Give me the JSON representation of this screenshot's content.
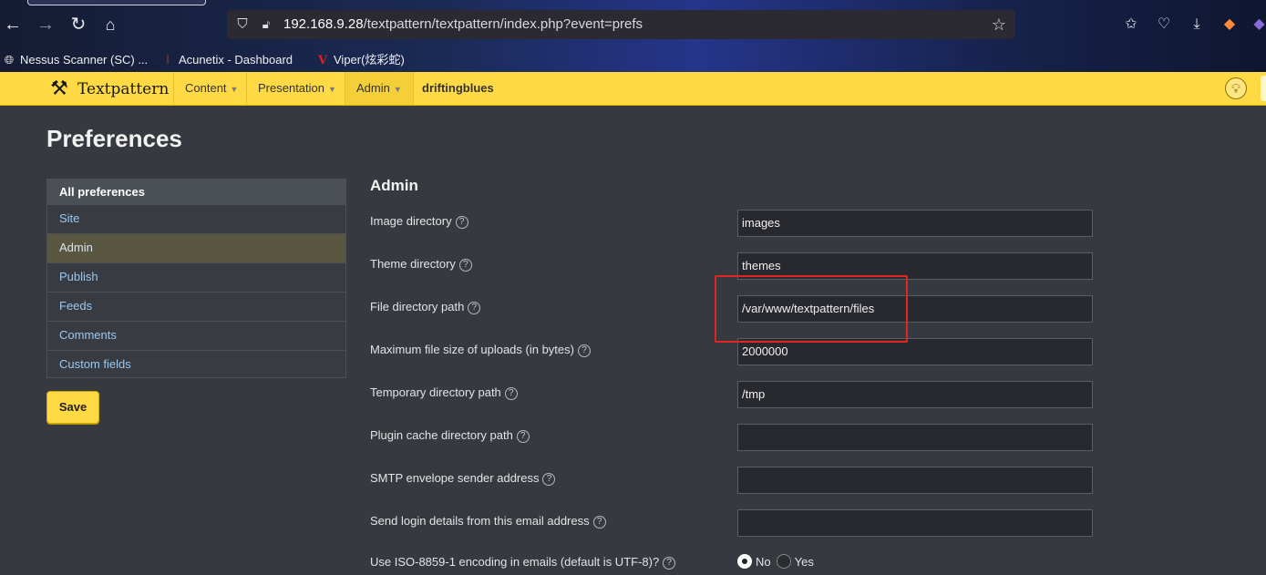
{
  "browser": {
    "url_host": "192.168.9.28",
    "url_path": "/textpattern/textpattern/index.php?event=prefs",
    "bookmarks": [
      {
        "label": "Nessus Scanner (SC) ...",
        "icon": "globe-icon"
      },
      {
        "label": "Acunetix - Dashboard",
        "icon": "acunetix-icon"
      },
      {
        "label": "Viper(炫彩蛇)",
        "icon": "viper-icon"
      }
    ]
  },
  "header": {
    "logo": "Textpattern",
    "nav": [
      {
        "label": "Content"
      },
      {
        "label": "Presentation"
      },
      {
        "label": "Admin"
      }
    ],
    "site_name": "driftingblues"
  },
  "page": {
    "title": "Preferences",
    "save_label": "Save"
  },
  "sidebar": {
    "heading": "All preferences",
    "items": [
      {
        "label": "Site"
      },
      {
        "label": "Admin"
      },
      {
        "label": "Publish"
      },
      {
        "label": "Feeds"
      },
      {
        "label": "Comments"
      },
      {
        "label": "Custom fields"
      }
    ]
  },
  "section": {
    "title": "Admin",
    "fields": [
      {
        "label": "Image directory",
        "value": "images"
      },
      {
        "label": "Theme directory",
        "value": "themes"
      },
      {
        "label": "File directory path",
        "value": "/var/www/textpattern/files"
      },
      {
        "label": "Maximum file size of uploads (in bytes)",
        "value": "2000000"
      },
      {
        "label": "Temporary directory path",
        "value": "/tmp"
      },
      {
        "label": "Plugin cache directory path",
        "value": ""
      },
      {
        "label": "SMTP envelope sender address",
        "value": ""
      },
      {
        "label": "Send login details from this email address",
        "value": ""
      }
    ],
    "encoding": {
      "label": "Use ISO-8859-1 encoding in emails (default is UTF-8)?",
      "options": [
        {
          "label": "No",
          "selected": true
        },
        {
          "label": "Yes",
          "selected": false
        }
      ]
    }
  },
  "colors": {
    "accent": "#ffda44",
    "page_bg": "#363a40",
    "highlight": "#e0261f"
  }
}
